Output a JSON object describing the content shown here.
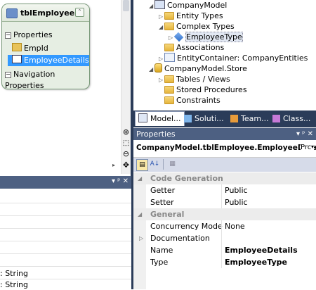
{
  "entity": {
    "title": "tblEmployee",
    "properties_label": "Properties",
    "prop1": "EmpId",
    "prop2": "EmployeeDetails",
    "nav_label": "Navigation Properties"
  },
  "tree": {
    "items": [
      {
        "label": "CompanyModel"
      },
      {
        "label": "Entity Types"
      },
      {
        "label": "Complex Types"
      },
      {
        "label": "EmployeeType"
      },
      {
        "label": "Associations"
      },
      {
        "label": "EntityContainer: CompanyEntities"
      },
      {
        "label": "CompanyModel.Store"
      },
      {
        "label": "Tables / Views"
      },
      {
        "label": "Stored Procedures"
      },
      {
        "label": "Constraints"
      }
    ]
  },
  "tabs": [
    {
      "label": "Model..."
    },
    {
      "label": "Soluti..."
    },
    {
      "label": "Team..."
    },
    {
      "label": "Class..."
    }
  ],
  "properties": {
    "title": "Properties",
    "title_controls": "▾ ᵖ ✕",
    "selector": "CompanyModel.tblEmployee.EmployeeDetails",
    "selector_suffix": "Prc",
    "rows": [
      {
        "name": "Code Generation",
        "value": "",
        "category": true
      },
      {
        "name": "Getter",
        "value": "Public"
      },
      {
        "name": "Setter",
        "value": "Public"
      },
      {
        "name": "General",
        "value": "",
        "category": true
      },
      {
        "name": "Concurrency Mode",
        "value": "None"
      },
      {
        "name": "Documentation",
        "value": ""
      },
      {
        "name": "Name",
        "value": "EmployeeDetails"
      },
      {
        "name": "Type",
        "value": "EmployeeType"
      }
    ]
  },
  "bottom_left": {
    "controls": "▾ ᵖ ✕",
    "lines": [
      ": String",
      ": String"
    ]
  },
  "colors": {
    "title_bar": "#4d6082",
    "tab_strip": "#2b3c59",
    "selection": "#3399ff"
  }
}
